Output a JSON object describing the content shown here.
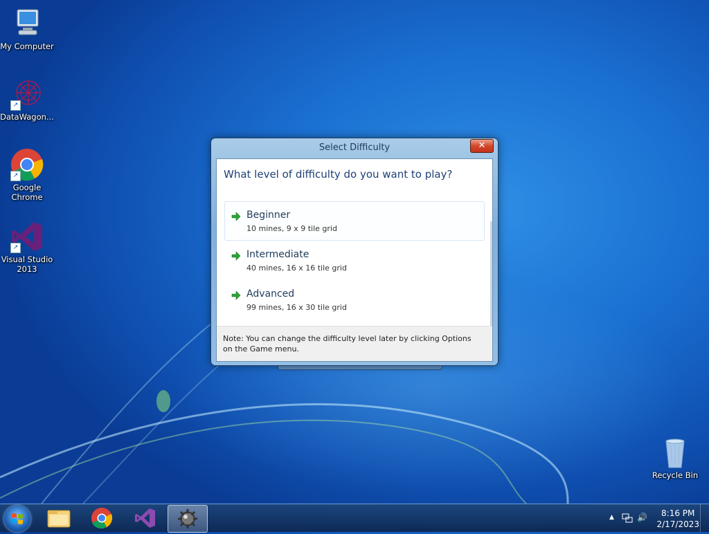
{
  "desktop": {
    "icons": [
      {
        "label": "My Computer"
      },
      {
        "label": "DataWagon..."
      },
      {
        "label": "Google\nChrome"
      },
      {
        "label": "Visual Studio\n2013"
      },
      {
        "label": "Recycle Bin"
      }
    ]
  },
  "dialog": {
    "title": "Select Difficulty",
    "close_label": "✕",
    "question": "What level of difficulty do you want to play?",
    "options": [
      {
        "title": "Beginner",
        "desc": "10 mines, 9 x 9 tile grid"
      },
      {
        "title": "Intermediate",
        "desc": "40 mines, 16 x 16 tile grid"
      },
      {
        "title": "Advanced",
        "desc": "99 mines, 16 x 30 tile grid"
      }
    ],
    "note": "Note: You can change the difficulty level later by clicking Options on the Game menu."
  },
  "taskbar": {
    "time": "8:16 PM",
    "date": "2/17/2023",
    "tray_arrow": "▲",
    "volume_icon": "🔊"
  },
  "colors": {
    "accent": "#1e3f75",
    "option_arrow": "#2aa336",
    "close_button": "#c8391f"
  }
}
